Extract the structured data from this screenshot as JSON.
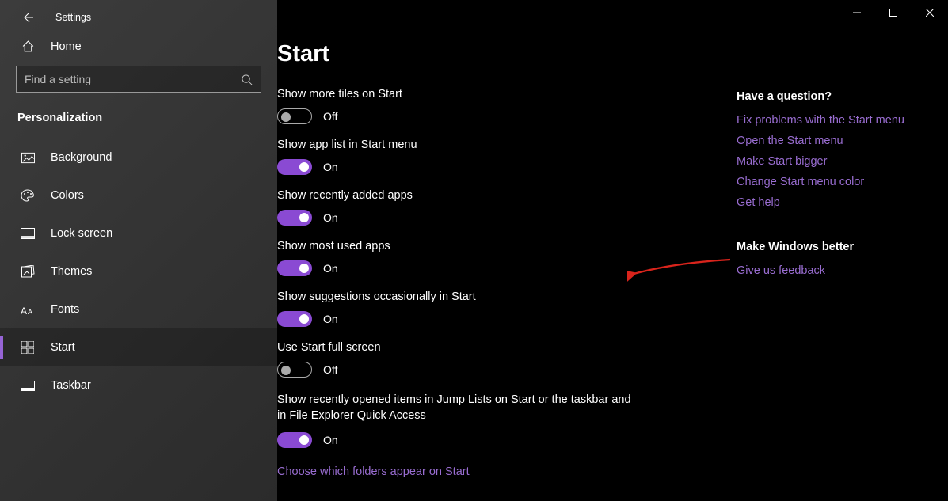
{
  "window": {
    "title": "Settings"
  },
  "sidebar": {
    "home_label": "Home",
    "search_placeholder": "Find a setting",
    "section": "Personalization",
    "items": [
      {
        "label": "Background"
      },
      {
        "label": "Colors"
      },
      {
        "label": "Lock screen"
      },
      {
        "label": "Themes"
      },
      {
        "label": "Fonts"
      },
      {
        "label": "Start"
      },
      {
        "label": "Taskbar"
      }
    ],
    "active_index": 5
  },
  "main": {
    "title": "Start",
    "settings": [
      {
        "label": "Show more tiles on Start",
        "on": false
      },
      {
        "label": "Show app list in Start menu",
        "on": true
      },
      {
        "label": "Show recently added apps",
        "on": true
      },
      {
        "label": "Show most used apps",
        "on": true
      },
      {
        "label": "Show suggestions occasionally in Start",
        "on": true
      },
      {
        "label": "Use Start full screen",
        "on": false
      },
      {
        "label": "Show recently opened items in Jump Lists on Start or the taskbar and in File Explorer Quick Access",
        "on": true,
        "multiline": true
      }
    ],
    "toggle_on_text": "On",
    "toggle_off_text": "Off",
    "footer_link": "Choose which folders appear on Start"
  },
  "help": {
    "title": "Have a question?",
    "links": [
      "Fix problems with the Start menu",
      "Open the Start menu",
      "Make Start bigger",
      "Change Start menu color",
      "Get help"
    ],
    "feedback_title": "Make Windows better",
    "feedback_link": "Give us feedback"
  }
}
